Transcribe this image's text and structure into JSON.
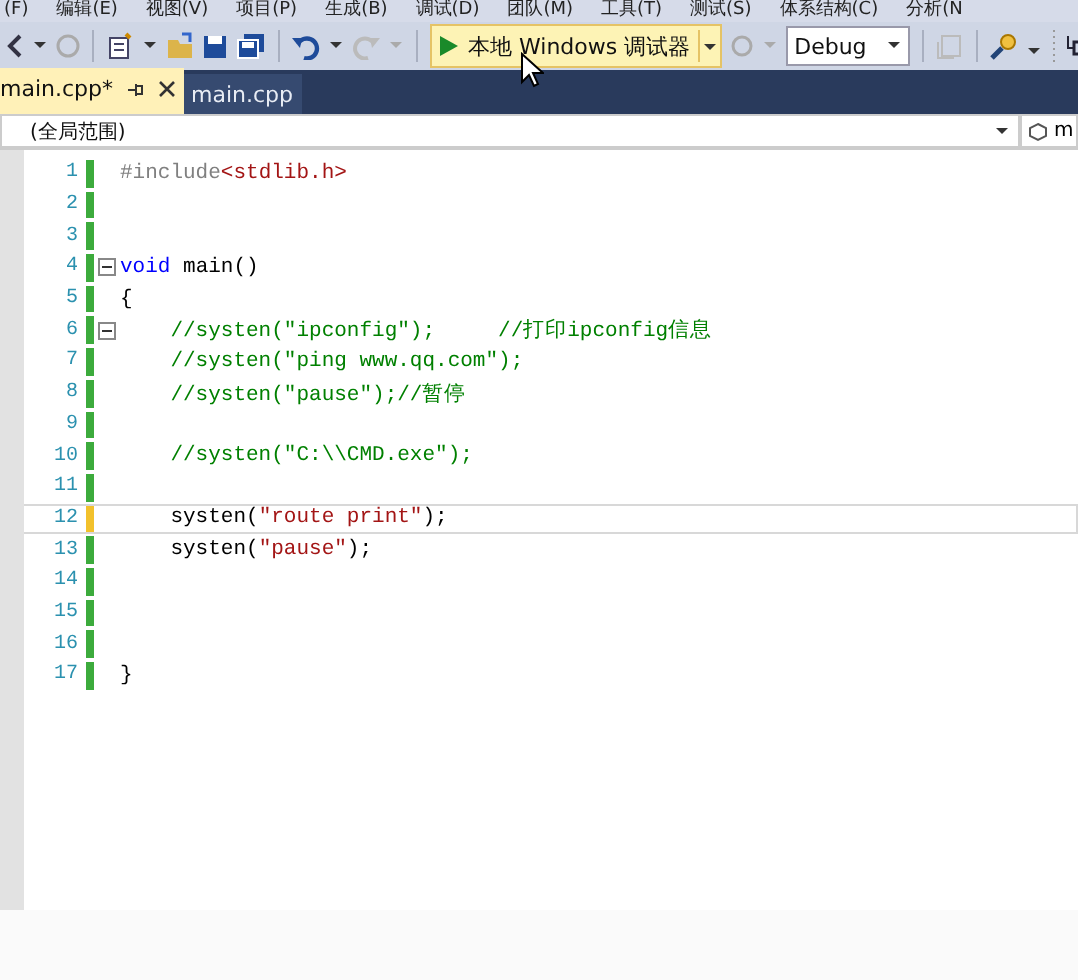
{
  "menu": [
    "(F)",
    "编辑(E)",
    "视图(V)",
    "项目(P)",
    "生成(B)",
    "调试(D)",
    "团队(M)",
    "工具(T)",
    "测试(S)",
    "体系结构(C)",
    "分析(N"
  ],
  "toolbar": {
    "run_button": "本地 Windows 调试器",
    "configuration": "Debug"
  },
  "tabs": [
    {
      "label": "main.cpp*",
      "selected": true
    },
    {
      "label": "main.cpp",
      "selected": false
    }
  ],
  "scope_bar": {
    "scope": "(全局范围)",
    "member": "m"
  },
  "editor": {
    "lines": [
      {
        "number": "1",
        "unsaved": false,
        "current": false,
        "fold": false,
        "segments": [
          {
            "kind": "directive",
            "text": "#include"
          },
          {
            "kind": "string",
            "text": "<stdlib.h>"
          }
        ]
      },
      {
        "number": "2",
        "unsaved": false,
        "current": false,
        "fold": false
      },
      {
        "number": "3",
        "unsaved": false,
        "current": false,
        "fold": false
      },
      {
        "number": "4",
        "unsaved": false,
        "current": false,
        "fold": true,
        "segments": [
          {
            "kind": "keyword",
            "text": "void"
          },
          {
            "kind": "plain",
            "text": " main()"
          }
        ]
      },
      {
        "number": "5",
        "unsaved": false,
        "current": false,
        "fold": false,
        "segments": [
          {
            "kind": "plain",
            "text": "{"
          }
        ]
      },
      {
        "number": "6",
        "unsaved": false,
        "current": false,
        "fold": true,
        "segments": [
          {
            "kind": "comment",
            "text": "    //systen(\"ipconfig\");     //打印ipconfig信息"
          }
        ]
      },
      {
        "number": "7",
        "unsaved": false,
        "current": false,
        "fold": false,
        "segments": [
          {
            "kind": "comment",
            "text": "    //systen(\"ping www.qq.com\");"
          }
        ]
      },
      {
        "number": "8",
        "unsaved": false,
        "current": false,
        "fold": false,
        "segments": [
          {
            "kind": "comment",
            "text": "    //systen(\"pause\");//暂停"
          }
        ]
      },
      {
        "number": "9",
        "unsaved": false,
        "current": false,
        "fold": false
      },
      {
        "number": "10",
        "unsaved": false,
        "current": false,
        "fold": false,
        "segments": [
          {
            "kind": "comment",
            "text": "    //systen(\"C:\\\\CMD.exe\");"
          }
        ]
      },
      {
        "number": "11",
        "unsaved": false,
        "current": false,
        "fold": false
      },
      {
        "number": "12",
        "unsaved": true,
        "current": true,
        "fold": false,
        "segments": [
          {
            "kind": "plain",
            "text": "    systen("
          },
          {
            "kind": "string",
            "text": "\"route print\""
          },
          {
            "kind": "plain",
            "text": ");"
          }
        ]
      },
      {
        "number": "13",
        "unsaved": false,
        "current": false,
        "fold": false,
        "segments": [
          {
            "kind": "plain",
            "text": "    systen("
          },
          {
            "kind": "string",
            "text": "\"pause\""
          },
          {
            "kind": "plain",
            "text": ");"
          }
        ]
      },
      {
        "number": "14",
        "unsaved": false,
        "current": false,
        "fold": false
      },
      {
        "number": "15",
        "unsaved": false,
        "current": false,
        "fold": false
      },
      {
        "number": "16",
        "unsaved": false,
        "current": false,
        "fold": false
      },
      {
        "number": "17",
        "unsaved": false,
        "current": false,
        "fold": false,
        "segments": [
          {
            "kind": "plain",
            "text": "}"
          }
        ]
      }
    ]
  }
}
